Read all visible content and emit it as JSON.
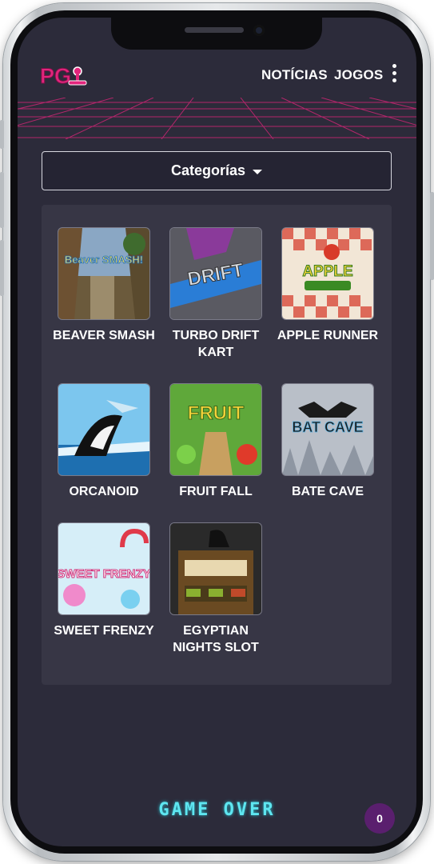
{
  "header": {
    "logo_text": "PG",
    "nav": [
      "NOTÍCIAS",
      "JOGOS"
    ]
  },
  "categories": {
    "label": "Categorías"
  },
  "games": [
    {
      "title": "BEAVER SMASH",
      "thumb_text": "Beaver SMASH!"
    },
    {
      "title": "TURBO DRIFT KART",
      "thumb_text": "DRIFT"
    },
    {
      "title": "APPLE RUNNER",
      "thumb_text": "APPLE"
    },
    {
      "title": "ORCANOID",
      "thumb_text": ""
    },
    {
      "title": "FRUIT FALL",
      "thumb_text": "FRUIT"
    },
    {
      "title": "BATE CAVE",
      "thumb_text": "BAT CAVE"
    },
    {
      "title": "SWEET FRENZY",
      "thumb_text": "SWEET FRENZY"
    },
    {
      "title": "EGYPTIAN NIGHTS SLOT",
      "thumb_text": ""
    }
  ],
  "footer": {
    "logo_text": "GAME OVER",
    "badge_count": "0"
  },
  "colors": {
    "screen_bg": "#2c2b3a",
    "panel_bg": "#373645",
    "accent_pink": "#e2257c",
    "footer_cyan": "#5ee6f0",
    "badge_purple": "#5a1f6e"
  }
}
